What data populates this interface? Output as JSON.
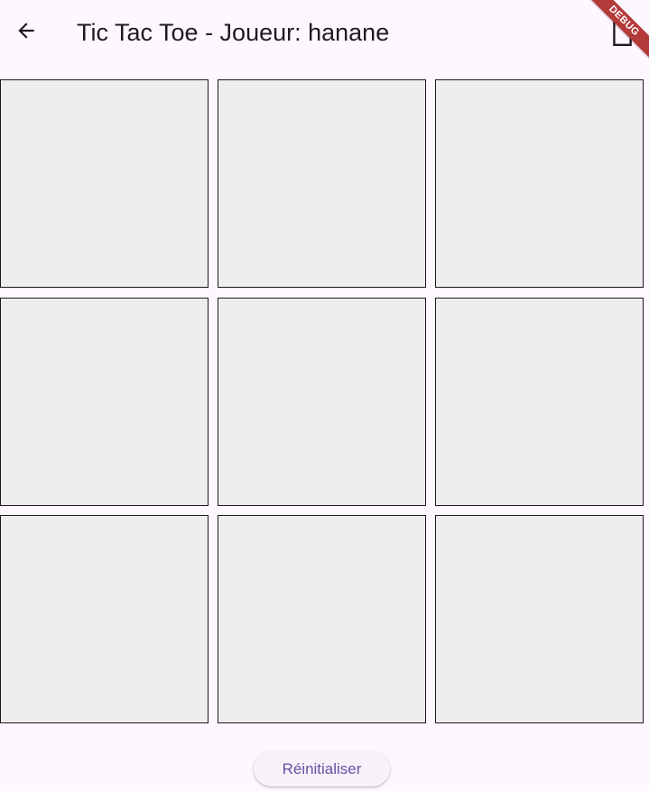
{
  "app_bar": {
    "back_icon": "arrow-left-icon",
    "title": "Tic Tac Toe - Joueur: hanane",
    "action_icon": "document-icon"
  },
  "debug_banner": {
    "label": "DEBUG",
    "color": "#b53a3a"
  },
  "board": {
    "cells": [
      "",
      "",
      "",
      "",
      "",
      "",
      "",
      "",
      ""
    ]
  },
  "reset_button": {
    "label": "Réinitialiser"
  },
  "colors": {
    "background": "#fef7ff",
    "cell_fill": "#eeeeee",
    "cell_border": "#1a1a1a",
    "accent": "#6750a4"
  }
}
